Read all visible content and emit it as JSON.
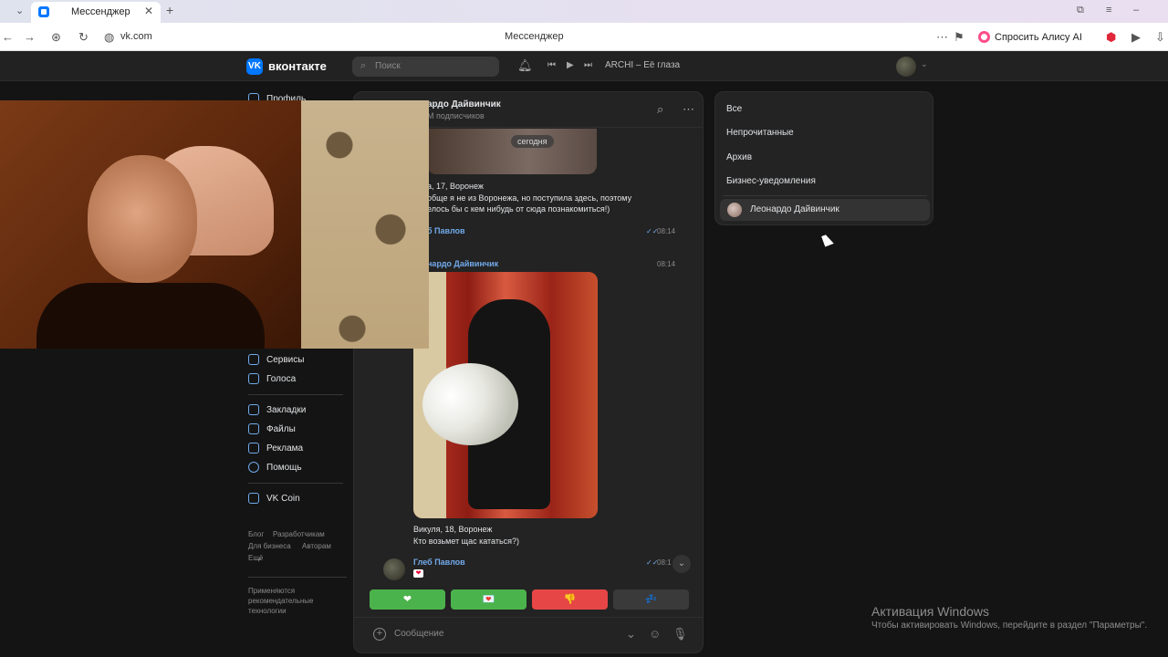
{
  "browser": {
    "tab_title": "Мессенджер",
    "url": "vk.com",
    "page_title": "Мессенджер",
    "alice_label": "Спросить Алису AI"
  },
  "header": {
    "brand": "вконтакте",
    "search_placeholder": "Поиск",
    "track": "ARCHI – Её глаза"
  },
  "sidebar": {
    "top_item": "Профиль",
    "items": [
      {
        "label": "Сервисы",
        "icon": "services-icon"
      },
      {
        "label": "Голоса",
        "icon": "coins-icon"
      },
      {
        "label": "Закладки",
        "icon": "bookmark-icon"
      },
      {
        "label": "Файлы",
        "icon": "file-icon"
      },
      {
        "label": "Реклама",
        "icon": "megaphone-icon"
      },
      {
        "label": "Помощь",
        "icon": "help-icon"
      },
      {
        "label": "VK Coin",
        "icon": "vkcoin-icon"
      }
    ],
    "footer_links": [
      "Блог",
      "Разработчикам",
      "Для бизнеса",
      "Авторам",
      "Ещё"
    ],
    "recommend_note": "Применяются рекомендательные технологии"
  },
  "chat": {
    "name": "ардо Дайвинчик",
    "subtitle": "М подписчиков",
    "date_pill": "сегодня",
    "msg1": "а, 17, Воронеж\nобще я не из Воронежа, но поступила здесь, поэтому\nелось бы с кем нибудь от сюда познакомиться!)",
    "msg1_author": "б Павлов",
    "msg1_time": "08:14",
    "msg2_author": "нардо Дайвинчик",
    "msg2_time": "08:14",
    "msg2_text": "Викуля, 18, Воронеж\nКто возьмет щас кататься?)",
    "msg3_author": "Глеб Павлов",
    "msg3_time": "08:1",
    "keyboard": [
      {
        "label": "❤",
        "color": "#4bb34b"
      },
      {
        "label": "💌",
        "color": "#4bb34b"
      },
      {
        "label": "👎",
        "color": "#e64646"
      },
      {
        "label": "💤",
        "color": "#3a3a3a"
      }
    ],
    "composer_placeholder": "Сообщение"
  },
  "filters": {
    "items": [
      "Все",
      "Непрочитанные",
      "Архив",
      "Бизнес-уведомления"
    ],
    "contact": "Леонардо Дайвинчик"
  },
  "watermark": {
    "title": "Активация Windows",
    "subtitle": "Чтобы активировать Windows, перейдите в раздел \"Параметры\"."
  }
}
